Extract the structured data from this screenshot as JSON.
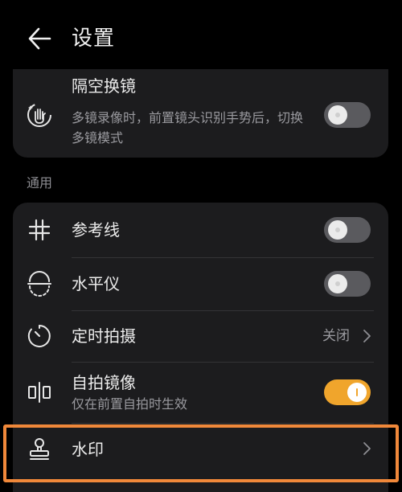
{
  "header": {
    "title": "设置"
  },
  "top_card": {
    "air_gesture": {
      "title": "隔空换镜",
      "subtitle": "多镜录像时，前置镜头识别手势后，切换多镜模式",
      "enabled": false
    }
  },
  "general": {
    "section_label": "通用",
    "items": [
      {
        "title": "参考线",
        "icon": "grid-icon",
        "enabled": false
      },
      {
        "title": "水平仪",
        "icon": "level-icon",
        "enabled": false
      },
      {
        "title": "定时拍摄",
        "icon": "timer-icon",
        "value": "关闭"
      },
      {
        "title": "自拍镜像",
        "subtitle": "仅在前置自拍时生效",
        "icon": "mirror-icon",
        "enabled": true
      },
      {
        "title": "水印",
        "icon": "stamp-icon"
      }
    ]
  },
  "colors": {
    "accent": "#f0a52c",
    "highlight_border": "#f0883a",
    "card_background": "#1c1c1e",
    "page_background": "#000000"
  }
}
